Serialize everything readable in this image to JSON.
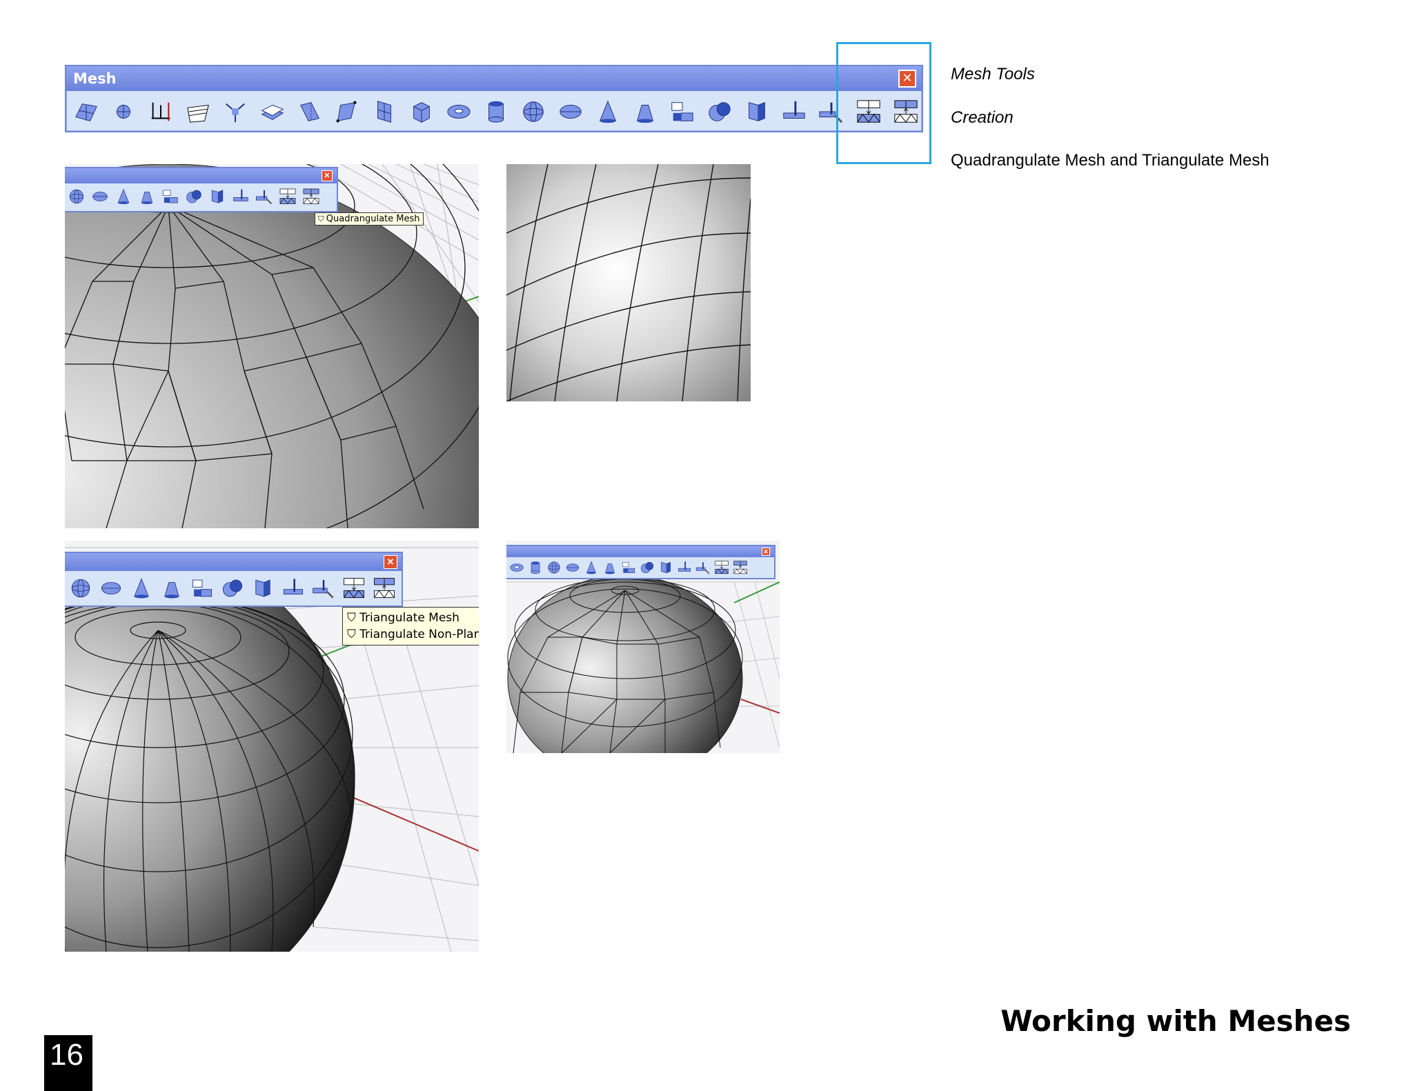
{
  "toolbar": {
    "title": "Mesh",
    "close_label": "✕",
    "icons": [
      "mesh-plane-icon",
      "mesh-from-points-icon",
      "mesh-from-axis-icon",
      "mesh-from-curves-icon",
      "mesh-explode-icon",
      "mesh-surface-icon",
      "mesh-patch-icon",
      "mesh-polyline-icon",
      "mesh-box-plane-icon",
      "mesh-box-icon",
      "mesh-torus-icon",
      "mesh-cylinder-icon",
      "mesh-sphere-icon",
      "mesh-ellipsoid-icon",
      "mesh-cone-icon",
      "mesh-truncated-cone-icon",
      "mesh-tools-icon",
      "mesh-boolean-icon",
      "mesh-extrude-icon",
      "mesh-split-icon",
      "mesh-trim-icon",
      "quadrangulate-mesh-icon",
      "triangulate-mesh-icon"
    ]
  },
  "captions": {
    "section": "Mesh Tools",
    "subsection": "Creation",
    "description": "Quadrangulate Mesh and Triangulate Mesh"
  },
  "tooltips": {
    "quadrangulate": "Quadrangulate Mesh",
    "triangulate": "Triangulate Mesh",
    "triangulate_nonplanar": "Triangulate Non-Plana"
  },
  "footer": {
    "page_title": "Working with Meshes",
    "page_number": "16"
  },
  "colors": {
    "highlight": "#2aa7dd",
    "toolbar_blue": "#6f86d6",
    "close_red": "#e0522e"
  }
}
